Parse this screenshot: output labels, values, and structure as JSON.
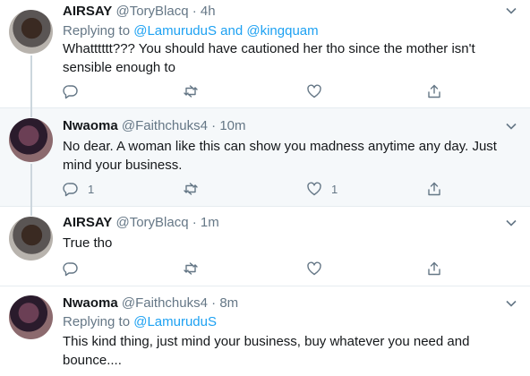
{
  "tweets": [
    {
      "name": "AIRSAY",
      "handle": "@ToryBlacq",
      "sep": "·",
      "time": "4h",
      "reply_prefix": "Replying to ",
      "reply_users": "@LamuruduS and @kingquam",
      "text": "Whatttttt??? You should have cautioned her tho since the mother isn't sensible enough to",
      "reply_count": "",
      "like_count": ""
    },
    {
      "name": "Nwaoma",
      "handle": "@Faithchuks4",
      "sep": "·",
      "time": "10m",
      "text": "No dear. A woman like this can show you madness anytime any day. Just mind your business.",
      "reply_count": "1",
      "like_count": "1"
    },
    {
      "name": "AIRSAY",
      "handle": "@ToryBlacq",
      "sep": "·",
      "time": "1m",
      "text": "True tho",
      "reply_count": "",
      "like_count": ""
    },
    {
      "name": "Nwaoma",
      "handle": "@Faithchuks4",
      "sep": "·",
      "time": "8m",
      "reply_prefix": "Replying to ",
      "reply_users": "@LamuruduS",
      "text": "This kind thing, just mind your business, buy whatever you need and bounce...."
    }
  ],
  "icons": {
    "reply": "reply-icon",
    "retweet": "retweet-icon",
    "like": "heart-icon",
    "share": "share-icon",
    "menu": "chevron-down-icon"
  },
  "colors": {
    "text": "#14171a",
    "muted": "#657786",
    "link": "#1da1f2",
    "highlight_bg": "#f5f8fa",
    "divider": "#e6ecf0"
  }
}
